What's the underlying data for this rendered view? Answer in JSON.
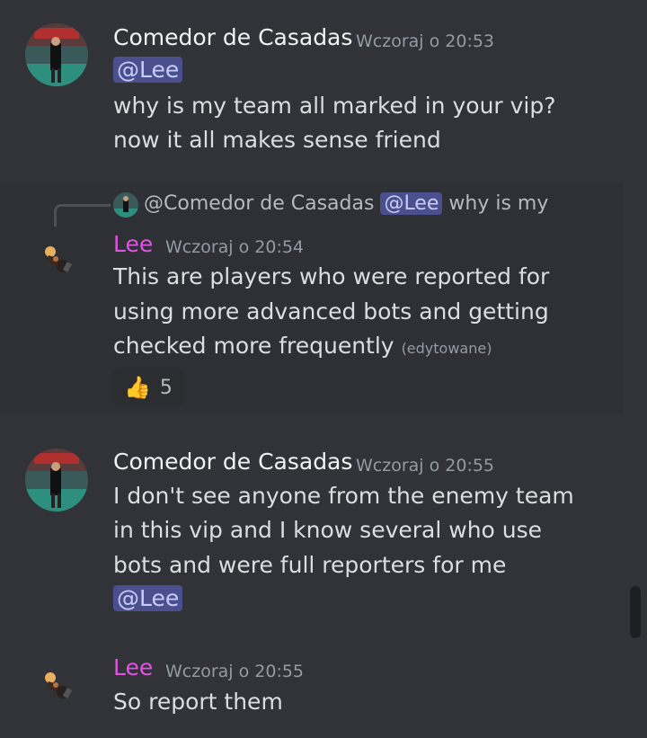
{
  "messages": [
    {
      "author": "Comedor de Casadas",
      "timestamp": "Wczoraj o 20:53",
      "mention": "@Lee",
      "lines": [
        "why is my team all marked in your vip?",
        "now it all makes sense friend"
      ]
    },
    {
      "reply": {
        "author": "@Comedor de Casadas",
        "mention": "@Lee",
        "preview": "why is my team all marked in your vip?"
      },
      "author": "Lee",
      "timestamp": "Wczoraj o 20:54",
      "lines": [
        "This are players who were reported for",
        "using more advanced bots and getting",
        "checked more frequently"
      ],
      "edited": "(edytowane)",
      "reaction": {
        "emoji": "👍",
        "count": "5"
      }
    },
    {
      "author": "Comedor de Casadas",
      "timestamp": "Wczoraj o 20:55",
      "lines": [
        "I don't see anyone from the enemy team",
        "in this vip and I know several who use",
        "bots and were full reporters for me"
      ],
      "mention": "@Lee"
    },
    {
      "author": "Lee",
      "timestamp": "Wczoraj o 20:55",
      "lines": [
        "So report them"
      ]
    }
  ],
  "colors": {
    "background": "#313338",
    "mention_bg": "#4a4f8d",
    "lee_name": "#e052e0"
  },
  "icons": {
    "reaction_icon": "thumbs-up-icon"
  }
}
